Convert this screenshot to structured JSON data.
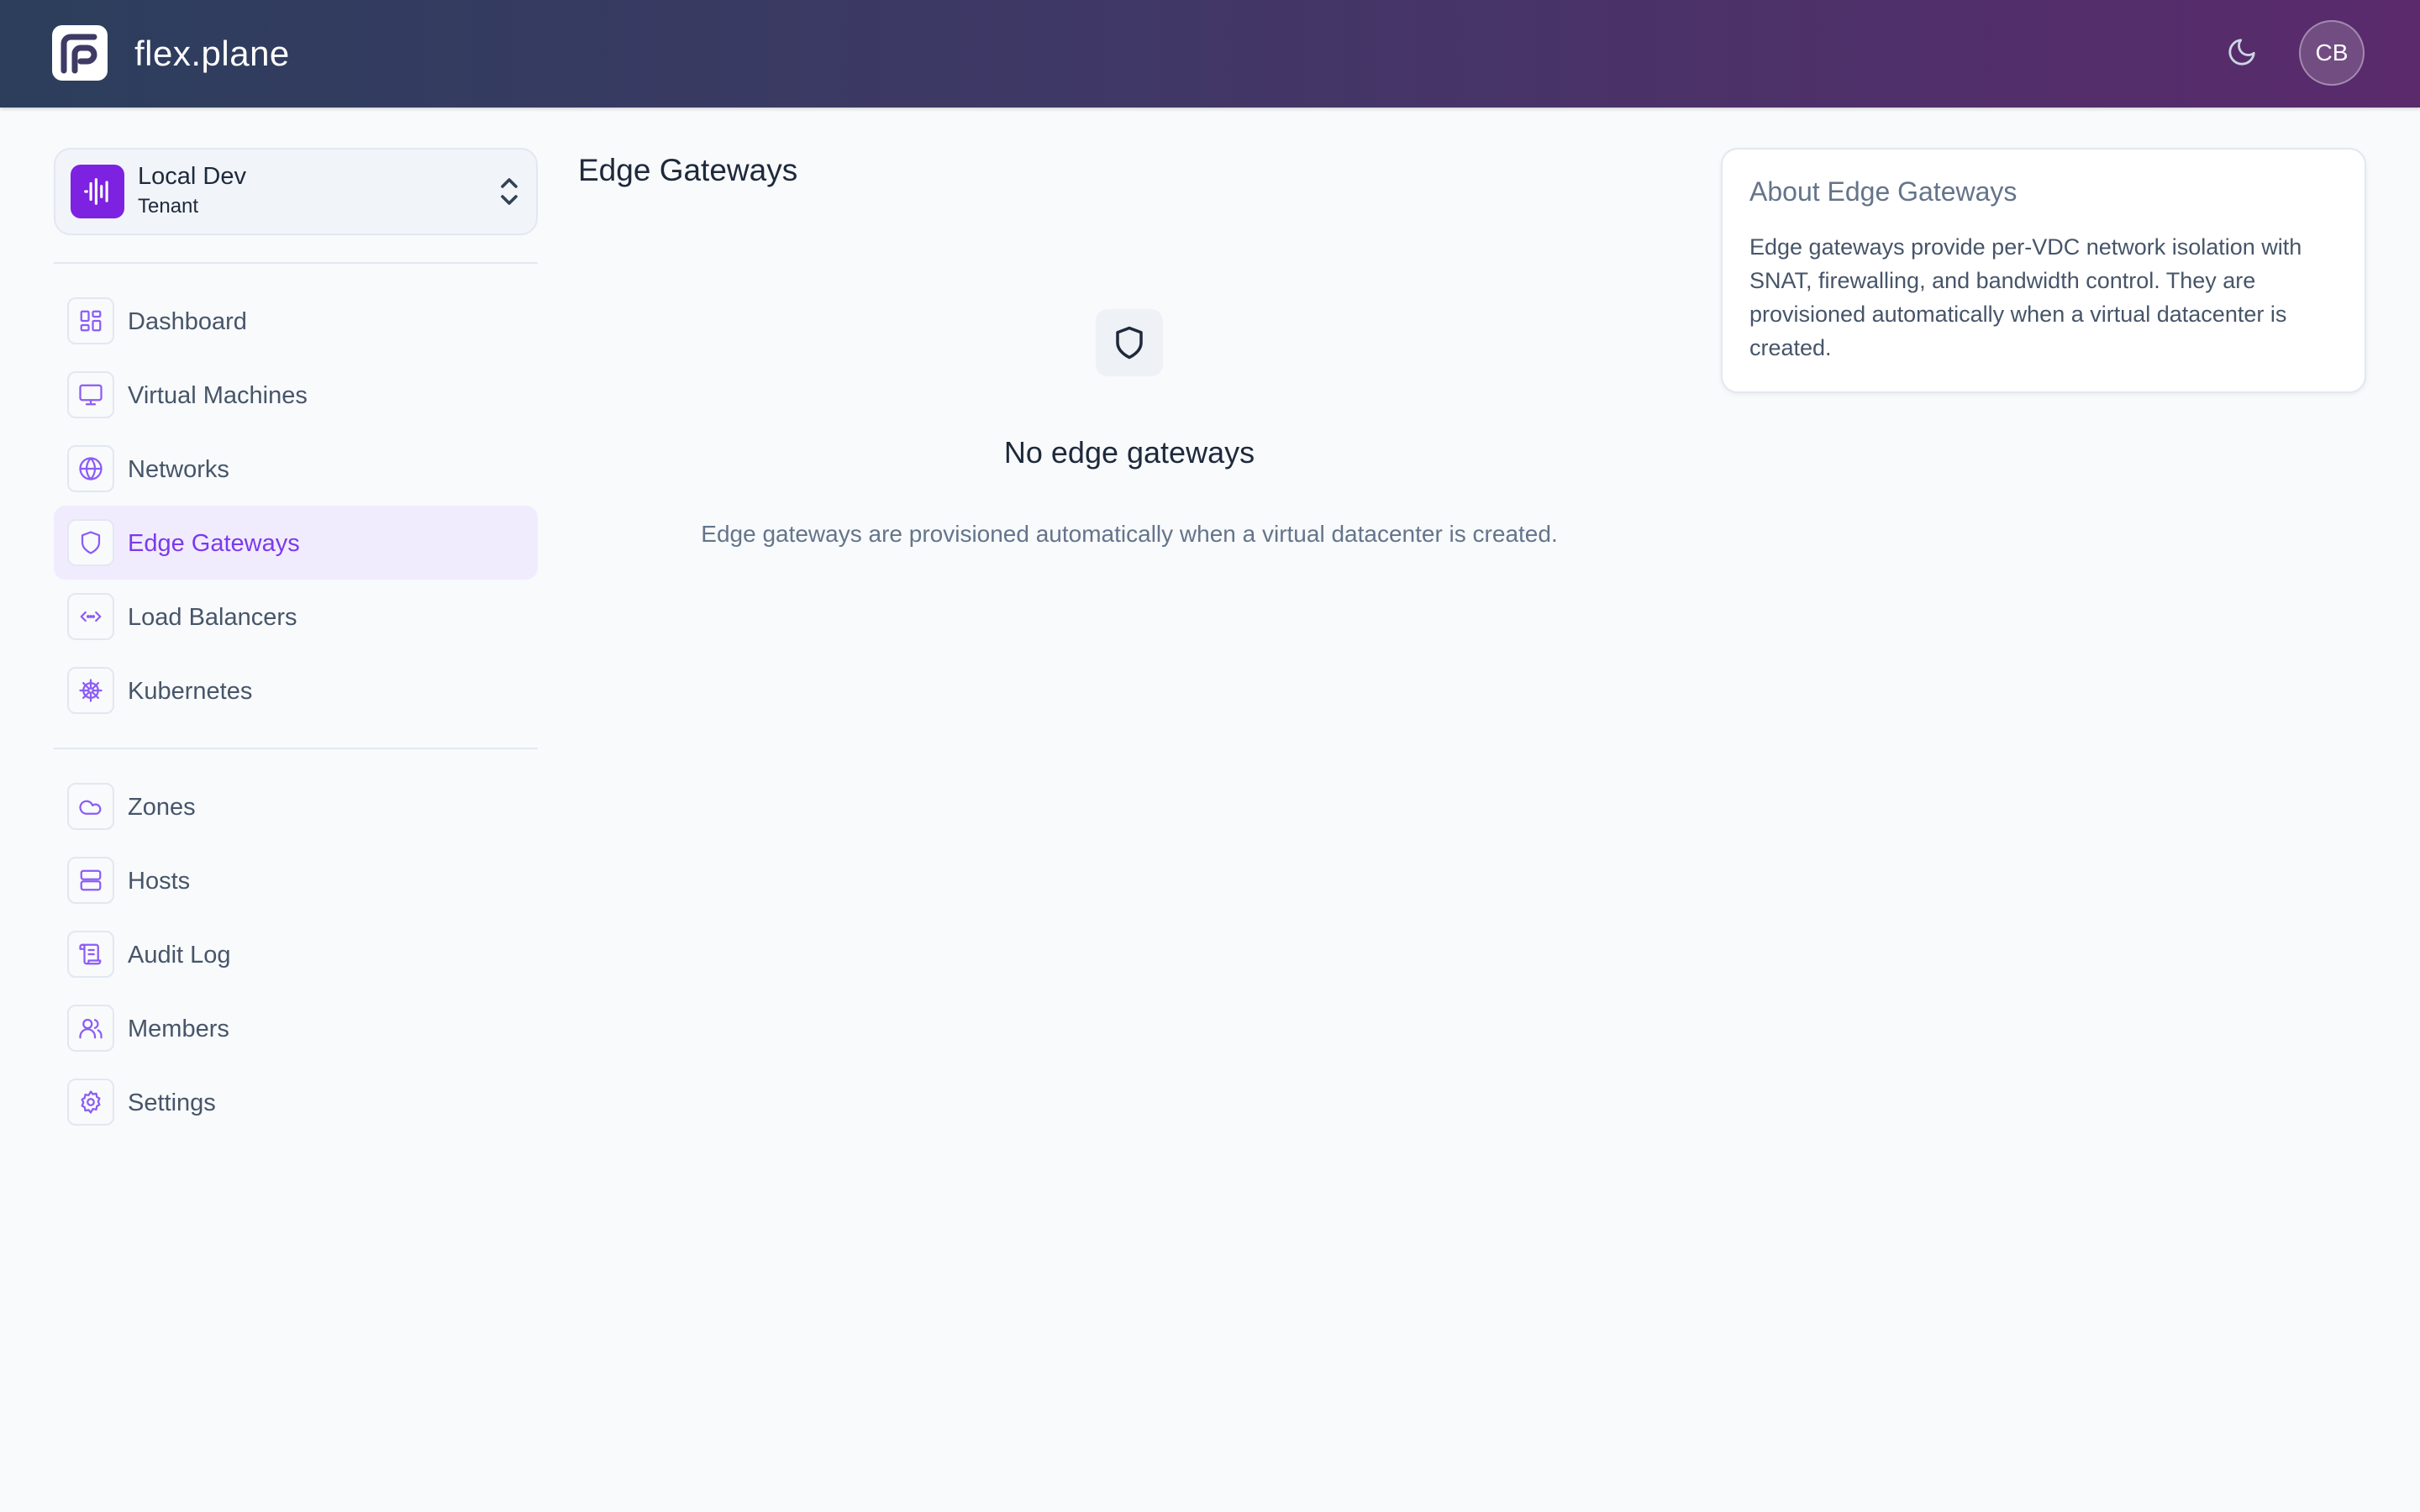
{
  "app": {
    "brand": "flex.plane",
    "user_initials": "CB"
  },
  "icons": {
    "logo": "flexplane-logo-icon",
    "theme": "moon-icon",
    "tenant": "waveform-icon",
    "tenant_switch": "chevrons-up-down-icon",
    "empty": "shield-icon"
  },
  "colors": {
    "accent": "#7c3aed",
    "tenant_icon_bg": "#7c22e0"
  },
  "tenant": {
    "name": "Local Dev",
    "role": "Tenant"
  },
  "sidebar": {
    "primary": [
      {
        "label": "Dashboard",
        "icon": "dashboard-icon"
      },
      {
        "label": "Virtual Machines",
        "icon": "monitor-icon"
      },
      {
        "label": "Networks",
        "icon": "globe-icon"
      },
      {
        "label": "Edge Gateways",
        "icon": "shield-icon",
        "active": true
      },
      {
        "label": "Load Balancers",
        "icon": "code-arrows-icon"
      },
      {
        "label": "Kubernetes",
        "icon": "helm-icon"
      }
    ],
    "secondary": [
      {
        "label": "Zones",
        "icon": "cloud-icon"
      },
      {
        "label": "Hosts",
        "icon": "server-icon"
      },
      {
        "label": "Audit Log",
        "icon": "scroll-icon"
      },
      {
        "label": "Members",
        "icon": "users-icon"
      },
      {
        "label": "Settings",
        "icon": "gear-icon"
      }
    ]
  },
  "main": {
    "title": "Edge Gateways",
    "empty": {
      "title": "No edge gateways",
      "description": "Edge gateways are provisioned automatically when a virtual datacenter is created."
    }
  },
  "about": {
    "title": "About Edge Gateways",
    "text": "Edge gateways provide per-VDC network isolation with SNAT, firewalling, and bandwidth control. They are provisioned automatically when a virtual datacenter is created."
  }
}
